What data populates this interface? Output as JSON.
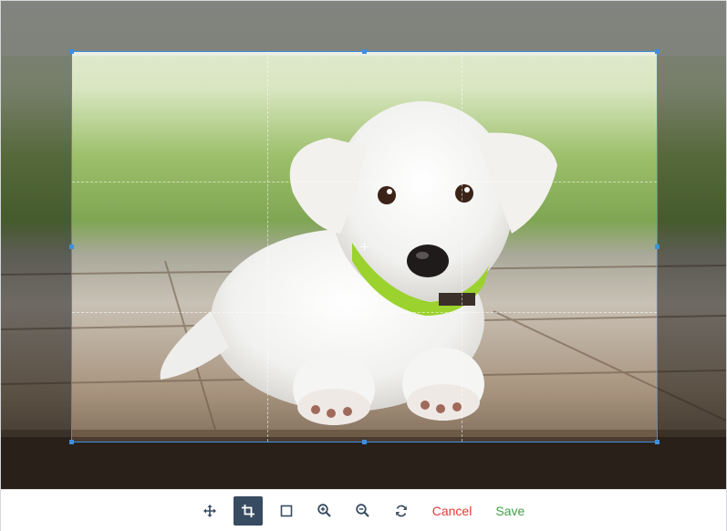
{
  "toolbar": {
    "tools": [
      {
        "name": "move-tool",
        "icon": "move-icon",
        "active": false
      },
      {
        "name": "crop-tool",
        "icon": "crop-icon",
        "active": true
      },
      {
        "name": "aspect-ratio-tool",
        "icon": "square-icon",
        "active": false
      },
      {
        "name": "zoom-in-tool",
        "icon": "zoom-in-icon",
        "active": false
      },
      {
        "name": "zoom-out-tool",
        "icon": "zoom-out-icon",
        "active": false
      },
      {
        "name": "reset-tool",
        "icon": "rotate-icon",
        "active": false
      }
    ],
    "cancel_label": "Cancel",
    "save_label": "Save"
  },
  "colors": {
    "accent": "#3d8fe0",
    "active_tool_bg": "#374b61",
    "cancel": "#e53935",
    "save": "#43a047"
  }
}
